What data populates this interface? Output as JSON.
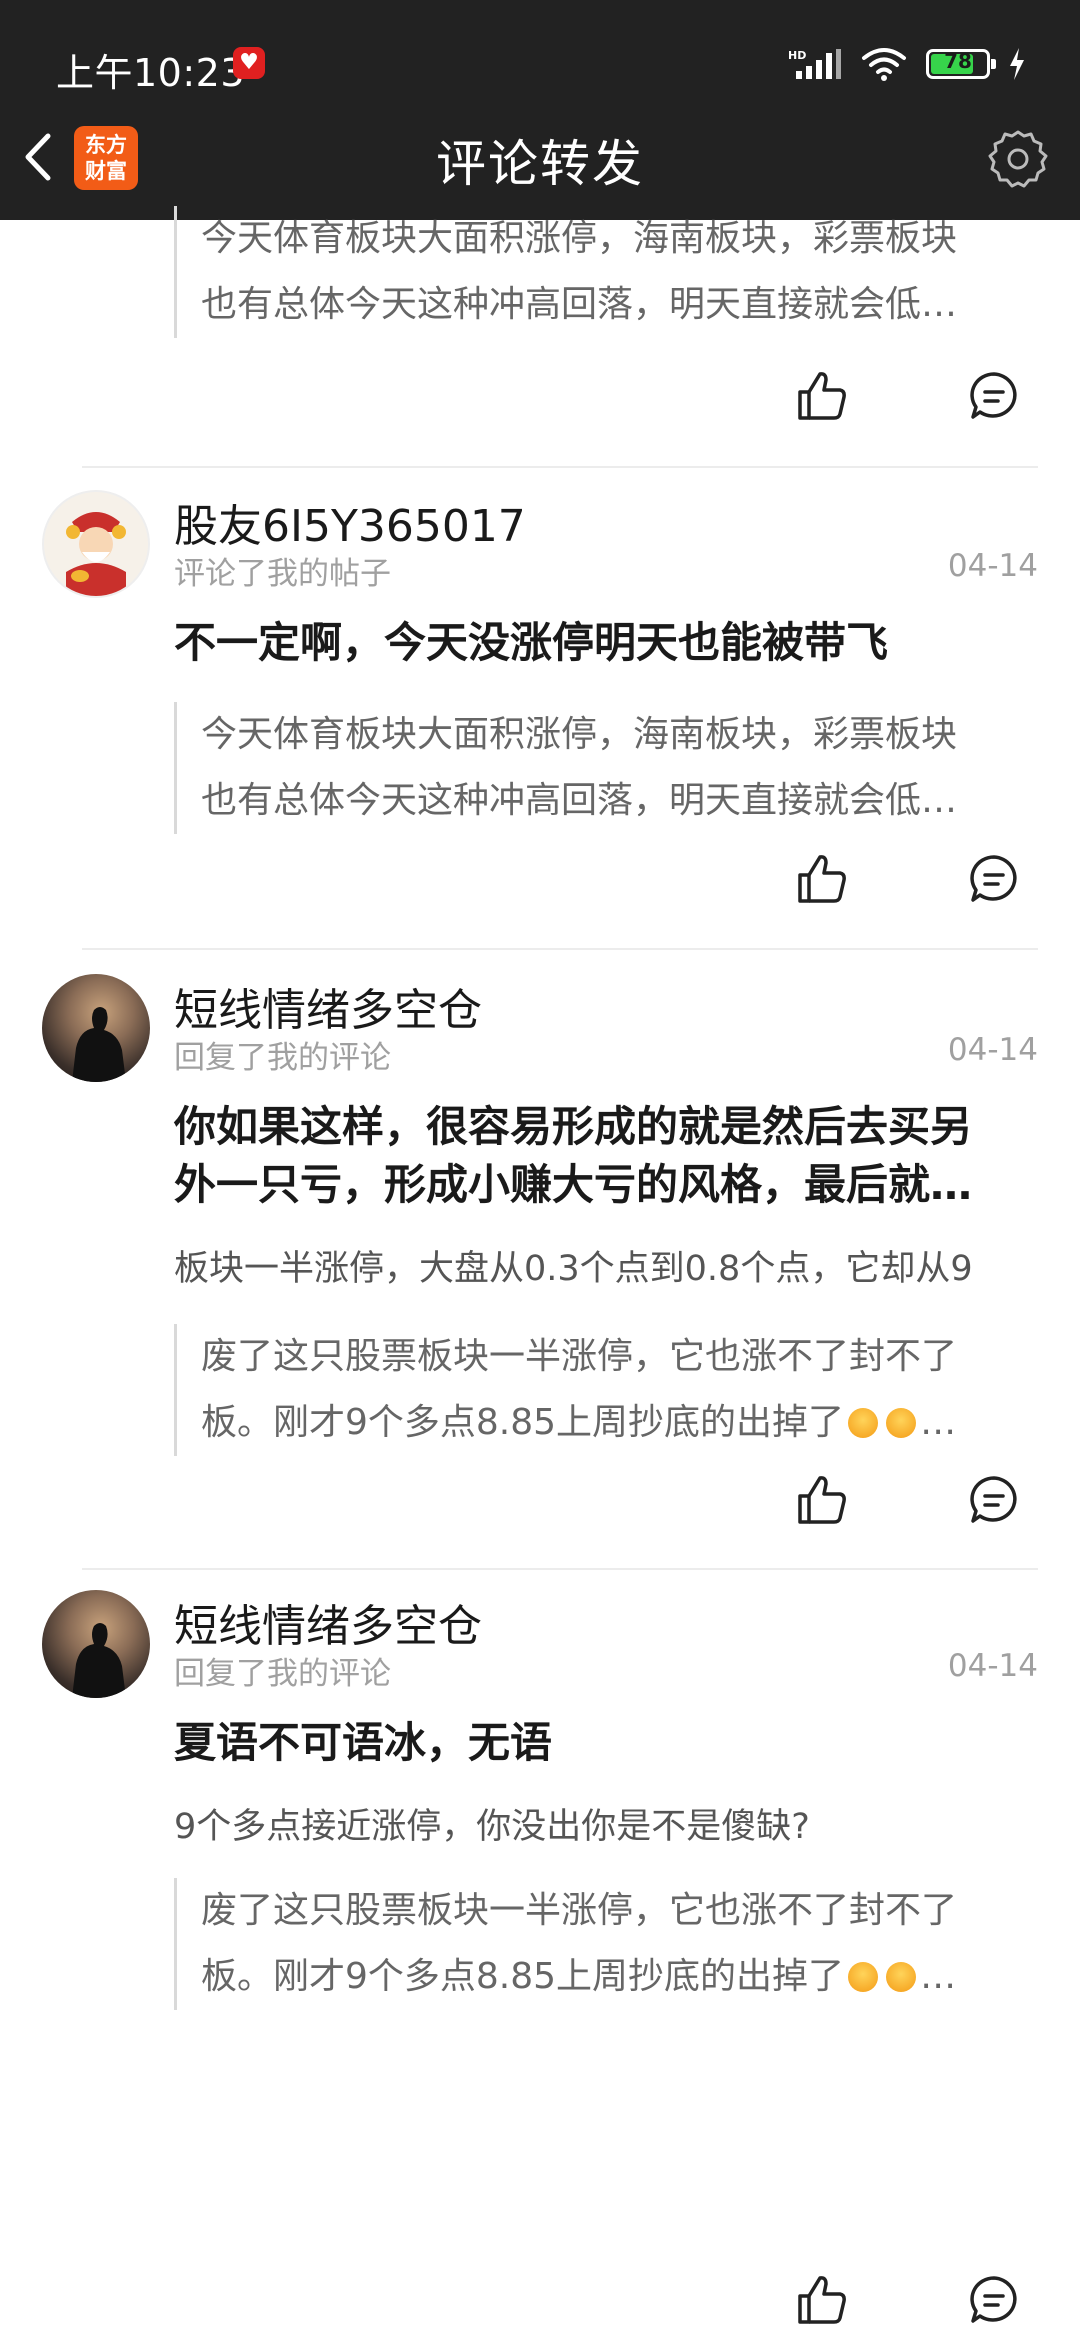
{
  "status_bar": {
    "time": "上午10:23",
    "battery": "78",
    "battery_fraction": 0.78
  },
  "header": {
    "title": "评论转发",
    "app_logo_text": "东方\n财富"
  },
  "top_partial_quote": {
    "line1": "今天体育板块大面积涨停，海南板块，彩票板块",
    "line2": "也有总体今天这种冲高回落，明天直接就会低…"
  },
  "cards": [
    {
      "username": "股友6I5Y365017",
      "action": "评论了我的帖子",
      "date": "04-14",
      "comment": "不一定啊，今天没涨停明天也能被带飞",
      "quote_line1": "今天体育板块大面积涨停，海南板块，彩票板块",
      "quote_line2": "也有总体今天这种冲高回落，明天直接就会低…"
    },
    {
      "username": "短线情绪多空仓",
      "action": "回复了我的评论",
      "date": "04-14",
      "comment_line1": "你如果这样，很容易形成的就是然后去买另",
      "comment_line2": "外一只亏，形成小赚大亏的风格，最后就…",
      "reply": "板块一半涨停，大盘从0.3个点到0.8个点，它却从9",
      "quote_line1": "废了这只股票板块一半涨停，它也涨不了封不了",
      "quote_line2": "板。刚才9个多点8.85上周抄底的出掉了",
      "quote_ellipsis": "…"
    },
    {
      "username": "短线情绪多空仓",
      "action": "回复了我的评论",
      "date": "04-14",
      "comment": "夏语不可语冰，无语",
      "reply": "9个多点接近涨停，你没出你是不是傻缺?",
      "quote_line1": "废了这只股票板块一半涨停，它也涨不了封不了",
      "quote_line2": "板。刚才9个多点8.85上周抄底的出掉了",
      "quote_ellipsis": "…"
    }
  ]
}
